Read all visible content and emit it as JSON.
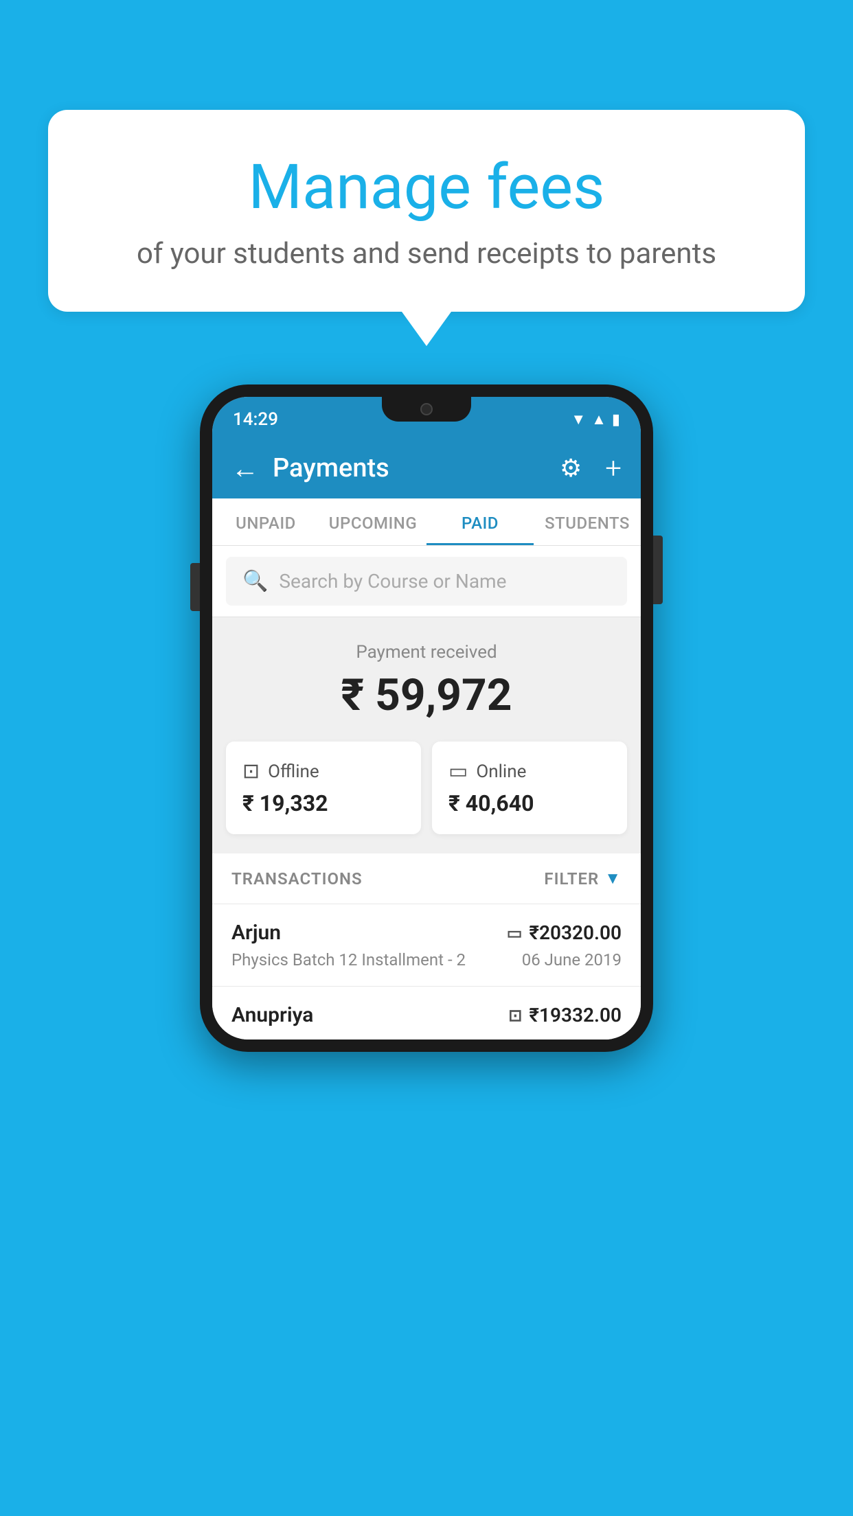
{
  "background_color": "#1ab0e8",
  "speech_bubble": {
    "title": "Manage fees",
    "subtitle": "of your students and send receipts to parents"
  },
  "status_bar": {
    "time": "14:29",
    "icons": [
      "wifi",
      "signal",
      "battery"
    ]
  },
  "header": {
    "title": "Payments",
    "back_label": "←",
    "gear_label": "⚙",
    "plus_label": "+"
  },
  "tabs": [
    {
      "label": "UNPAID",
      "active": false
    },
    {
      "label": "UPCOMING",
      "active": false
    },
    {
      "label": "PAID",
      "active": true
    },
    {
      "label": "STUDENTS",
      "active": false
    }
  ],
  "search": {
    "placeholder": "Search by Course or Name"
  },
  "payment_summary": {
    "received_label": "Payment received",
    "total_amount": "₹ 59,972",
    "offline_label": "Offline",
    "offline_amount": "₹ 19,332",
    "online_label": "Online",
    "online_amount": "₹ 40,640"
  },
  "transactions": {
    "header_label": "TRANSACTIONS",
    "filter_label": "FILTER",
    "rows": [
      {
        "name": "Arjun",
        "course": "Physics Batch 12 Installment - 2",
        "date": "06 June 2019",
        "amount": "₹20320.00",
        "payment_type": "card"
      },
      {
        "name": "Anupriya",
        "course": "",
        "date": "",
        "amount": "₹19332.00",
        "payment_type": "rupee"
      }
    ]
  }
}
